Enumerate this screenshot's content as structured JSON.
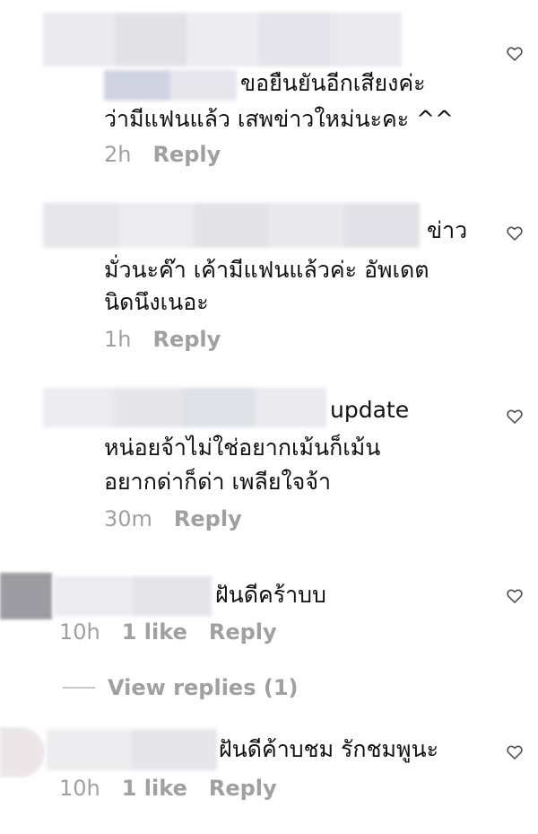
{
  "comments": [
    {
      "line1_suffix": "ขอยืนยันอีกเสียงค่ะ",
      "line2": "ว่ามีแฟนแล้ว เสพข่าวใหม่นะคะ ^^",
      "time": "2h",
      "reply_label": "Reply"
    },
    {
      "line1_suffix": "ข่าว",
      "line2": "มั่วนะค๊า เค้ามีแฟนแล้วค่ะ อัพเดต",
      "line3": "นิดนึงเนอะ",
      "time": "1h",
      "reply_label": "Reply"
    },
    {
      "line1_suffix": "update",
      "line2": "หน่อยจ้าไม่ใช่อยากเม้นก็เม้น",
      "line3": "อยากด่าก็ด่า เพลียใจจ้า",
      "time": "30m",
      "reply_label": "Reply"
    },
    {
      "line1_suffix": "ฝันดีคร้าบบ",
      "time": "10h",
      "likes": "1 like",
      "reply_label": "Reply",
      "view_replies": "View replies (1)"
    },
    {
      "line1_suffix": "ฝันดีค้าบชม รักชมพูนะ",
      "time": "10h",
      "likes": "1 like",
      "reply_label": "Reply"
    }
  ],
  "icons": {
    "like": "heart-outline-icon"
  },
  "colors": {
    "text": "#111111",
    "meta": "#a0a0a0",
    "heart": "#555555",
    "blur_light": "#e9e9ee",
    "blur_mid": "#dcdce3",
    "avatar_gray": "#9d9ca3"
  }
}
